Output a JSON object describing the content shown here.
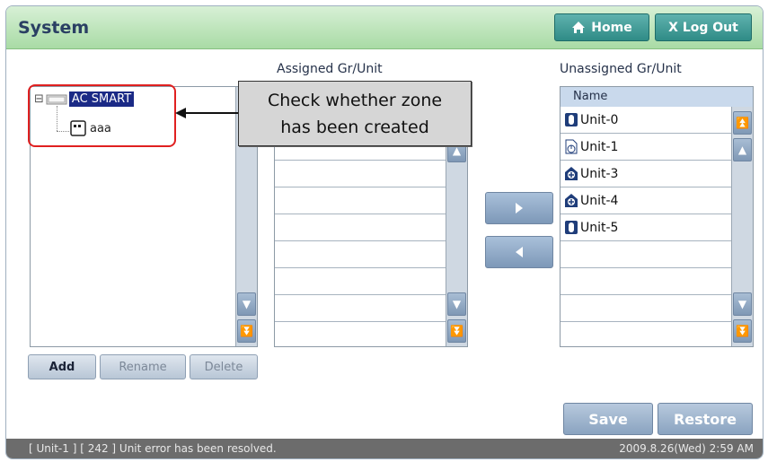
{
  "header": {
    "title": "System",
    "home_label": "Home",
    "logout_label": "X Log Out"
  },
  "tree": {
    "root_label": "AC SMART",
    "child_label": "aaa",
    "expander": "⊟"
  },
  "tree_buttons": {
    "add": "Add",
    "rename": "Rename",
    "delete": "Delete"
  },
  "assigned": {
    "title": "Assigned Gr/Unit",
    "rows": [
      "",
      "",
      "",
      "",
      "",
      "",
      "",
      ""
    ]
  },
  "unassigned": {
    "title": "Unassigned Gr/Unit",
    "column_header": "Name",
    "rows": [
      {
        "label": "Unit-0",
        "icon": "indoor-unit-icon"
      },
      {
        "label": "Unit-1",
        "icon": "power-unit-icon"
      },
      {
        "label": "Unit-3",
        "icon": "ventilation-unit-icon"
      },
      {
        "label": "Unit-4",
        "icon": "ventilation-unit-icon"
      },
      {
        "label": "Unit-5",
        "icon": "indoor-unit-icon"
      },
      {
        "label": ""
      },
      {
        "label": ""
      },
      {
        "label": ""
      }
    ]
  },
  "callout": {
    "line1": "Check whether zone",
    "line2": "has been created"
  },
  "actions": {
    "save": "Save",
    "restore": "Restore"
  },
  "status": {
    "message": "[ Unit-1 ] [ 242 ] Unit error has been resolved.",
    "datetime": "2009.8.26(Wed)  2:59 AM"
  },
  "colors": {
    "header_green": "#a9dba5",
    "teal_button": "#2f8b86",
    "highlight_red": "#e02020",
    "selection_navy": "#1b2a86"
  }
}
